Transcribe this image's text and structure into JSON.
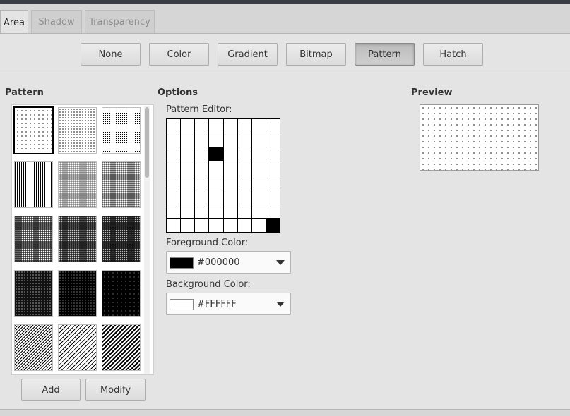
{
  "tabs": [
    {
      "label": "Area",
      "active": true
    },
    {
      "label": "Shadow",
      "active": false
    },
    {
      "label": "Transparency",
      "active": false
    }
  ],
  "fill_types": [
    {
      "label": "None",
      "pressed": false
    },
    {
      "label": "Color",
      "pressed": false
    },
    {
      "label": "Gradient",
      "pressed": false
    },
    {
      "label": "Bitmap",
      "pressed": false
    },
    {
      "label": "Pattern",
      "pressed": true
    },
    {
      "label": "Hatch",
      "pressed": false
    }
  ],
  "pattern_list": {
    "title": "Pattern",
    "selected_index": 0,
    "add_label": "Add",
    "modify_label": "Modify"
  },
  "options": {
    "title": "Options",
    "editor_label": "Pattern Editor:",
    "editor_active_cells": [
      [
        3,
        2
      ],
      [
        7,
        7
      ]
    ],
    "foreground": {
      "label": "Foreground Color:",
      "value": "#000000",
      "color": "#000000"
    },
    "background": {
      "label": "Background Color:",
      "value": "#FFFFFF",
      "color": "#FFFFFF"
    }
  },
  "preview": {
    "title": "Preview"
  }
}
